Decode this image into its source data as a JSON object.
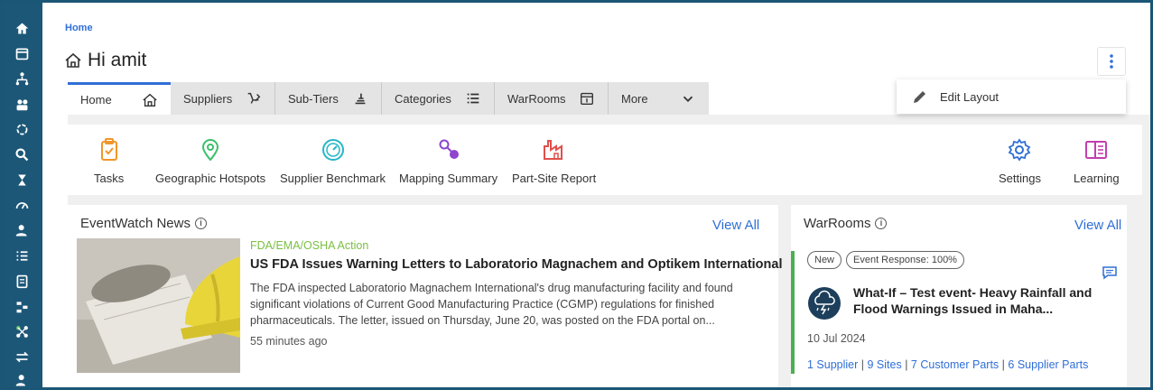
{
  "breadcrumb": "Home",
  "page_title": "Hi amit",
  "menu": {
    "edit_layout": "Edit Layout"
  },
  "tabs": [
    {
      "label": "Home",
      "icon": "home-icon"
    },
    {
      "label": "Suppliers",
      "icon": "suppliers-icon"
    },
    {
      "label": "Sub-Tiers",
      "icon": "sub-tiers-icon"
    },
    {
      "label": "Categories",
      "icon": "list-icon"
    },
    {
      "label": "WarRooms",
      "icon": "calendar-icon"
    },
    {
      "label": "More",
      "icon": "chevron-down-icon"
    }
  ],
  "quick_actions": [
    {
      "label": "Tasks",
      "icon": "clipboard-check-icon",
      "color": "#f0962b"
    },
    {
      "label": "Geographic Hotspots",
      "icon": "map-pin-icon",
      "color": "#3cbf6a"
    },
    {
      "label": "Supplier Benchmark",
      "icon": "gauge-icon",
      "color": "#25b7c7"
    },
    {
      "label": "Mapping Summary",
      "icon": "mapping-icon",
      "color": "#8e44ce"
    },
    {
      "label": "Part-Site Report",
      "icon": "factory-icon",
      "color": "#e0504b"
    },
    {
      "label": "Settings",
      "icon": "gear-icon",
      "color": "#2f6fd6"
    },
    {
      "label": "Learning",
      "icon": "book-icon",
      "color": "#c23fb0"
    }
  ],
  "eventwatch": {
    "title": "EventWatch News",
    "view_all": "View All",
    "category": "FDA/EMA/OSHA Action",
    "headline": "US FDA Issues Warning Letters to Laboratorio Magnachem and Optikem International",
    "body": "The FDA inspected Laboratorio Magnachem International's drug manufacturing facility and found significant violations of Current Good Manufacturing Practice (CGMP) regulations for finished pharmaceuticals. The letter, issued on Thursday, June 20, was posted on the FDA portal on...",
    "time": "55 minutes ago"
  },
  "warrooms": {
    "title": "WarRooms",
    "view_all": "View All",
    "badge_new": "New",
    "badge_response": "Event Response: 100%",
    "event_title": "What-If – Test event- Heavy Rainfall and Flood Warnings Issued in Maha...",
    "date": "10 Jul 2024",
    "links": [
      "1 Supplier",
      "9 Sites",
      "7 Customer Parts",
      "6 Supplier Parts"
    ]
  },
  "colors": {
    "accent": "#2f6fd6",
    "rail": "#1d5778",
    "warroom_accent": "#4caf50"
  }
}
